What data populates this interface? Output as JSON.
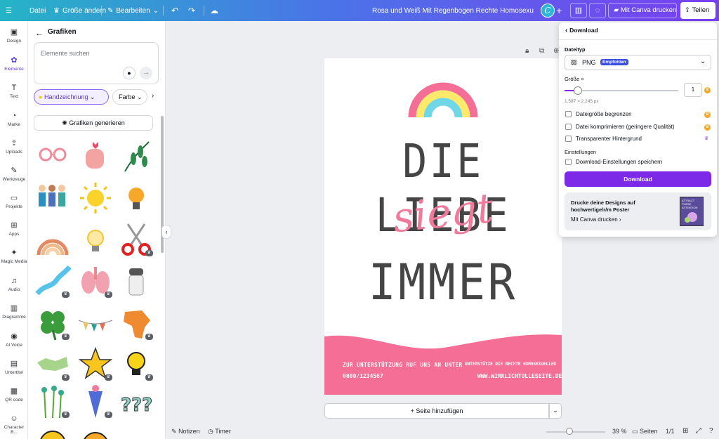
{
  "topbar": {
    "file": "Datei",
    "resize": "Größe ändern",
    "edit": "Bearbeiten",
    "title": "Rosa und Weiß Mit Regenbogen Rechte Homosexueller Zitat...",
    "avatar": "C",
    "print": "Mit Canva drucken",
    "share": "Teilen"
  },
  "rail": [
    {
      "label": "Design",
      "icon": "▣"
    },
    {
      "label": "Elemente",
      "icon": "✿"
    },
    {
      "label": "Text",
      "icon": "T"
    },
    {
      "label": "Marke",
      "icon": "◔"
    },
    {
      "label": "Uploads",
      "icon": "⇪"
    },
    {
      "label": "Werkzeuge",
      "icon": "✎"
    },
    {
      "label": "Projekte",
      "icon": "▭"
    },
    {
      "label": "Apps",
      "icon": "⊞"
    },
    {
      "label": "Magic Media",
      "icon": "✦"
    },
    {
      "label": "Audio",
      "icon": "♫"
    },
    {
      "label": "Diagramme",
      "icon": "▥"
    },
    {
      "label": "AI Voice",
      "icon": "◉"
    },
    {
      "label": "Untertitel",
      "icon": "▤"
    },
    {
      "label": "QR code",
      "icon": "▦"
    },
    {
      "label": "Character B...",
      "icon": "☺"
    }
  ],
  "panel": {
    "title": "Grafiken",
    "search_placeholder": "Elemente suchen",
    "filter1": "Handzeichnung",
    "filter2": "Farbe",
    "generate": "Grafiken generieren"
  },
  "canvas": {
    "line1": "DIE LIEBE",
    "line2": "siegt",
    "line3": "IMMER",
    "footer_left1": "ZUR UNTERSTÜTZUNG RUF UNS AN UNTER",
    "footer_left2": "0800/1234567",
    "footer_right1": "UNTERSTÜTZE DIE RECHTE HOMOSEXUELLER",
    "footer_right2": "WWW.WIRKLICHTOLLESEITE.DE",
    "add_page": "+ Seite hinzufügen",
    "colors": {
      "pink": "#f56e96",
      "script": "#f07a9c",
      "text": "#454545",
      "yellow": "#fde96a",
      "cyan": "#6fd7e6"
    }
  },
  "download": {
    "back": "Download",
    "filetype_label": "Dateityp",
    "filetype": "PNG",
    "recommended": "Empfohlen",
    "size_label": "Größe ×",
    "size_value": "1",
    "size_fraction": 0.12,
    "dimensions": "1.587 × 2.245 px",
    "opt1": "Dateigröße begrenzen",
    "opt2": "Datei komprimieren (geringere Qualität)",
    "opt3": "Transparenter Hintergrund",
    "settings_label": "Einstellungen",
    "opt4": "Download-Einstellungen speichern",
    "button": "Download",
    "promo_title": "Drucke deine Designs auf hochwertige/r/m Poster",
    "promo_link": "Mit Canva drucken",
    "promo_thumb": "ATTRACT THESE ATTENTION"
  },
  "bottombar": {
    "notes": "Notizen",
    "timer": "Timer",
    "zoom": "39 %",
    "zoom_fraction": 0.39,
    "pages": "Seiten",
    "page_count": "1/1"
  }
}
